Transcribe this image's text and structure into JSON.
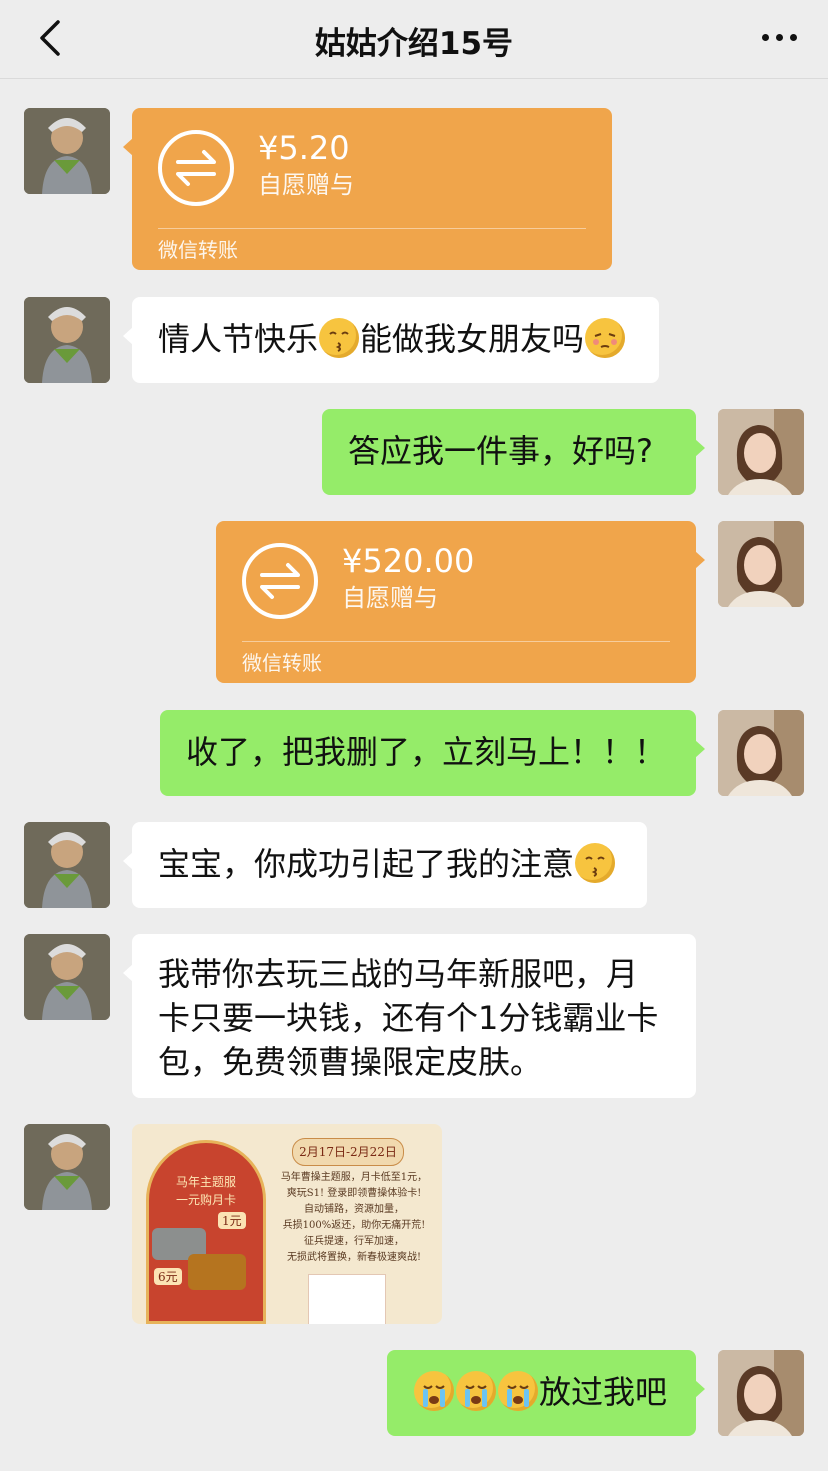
{
  "header": {
    "title": "姑姑介绍15号",
    "back_icon": "chevron-left-icon",
    "more_icon": "more-dots-icon"
  },
  "colors": {
    "background": "#ededed",
    "green_bubble": "#95ec69",
    "transfer_orange": "#f0a54b",
    "white_bubble": "#ffffff"
  },
  "messages": [
    {
      "side": "left",
      "type": "transfer",
      "amount": "¥5.20",
      "desc": "自愿赠与",
      "label": "微信转账"
    },
    {
      "side": "left",
      "type": "text",
      "text_a": "情人节快乐",
      "emoji_a": "kissing-face-emoji",
      "text_b": "能做我女朋友吗",
      "emoji_b": "shy-face-emoji"
    },
    {
      "side": "right",
      "type": "text",
      "text": "答应我一件事，好吗?"
    },
    {
      "side": "right",
      "type": "transfer",
      "amount": "¥520.00",
      "desc": "自愿赠与",
      "label": "微信转账"
    },
    {
      "side": "right",
      "type": "text",
      "text": "收了，把我删了，立刻马上！！！"
    },
    {
      "side": "left",
      "type": "text",
      "text": "宝宝，你成功引起了我的注意",
      "emoji": "kissing-face-emoji"
    },
    {
      "side": "left",
      "type": "text",
      "lines": [
        "我带你去玩三战的马年新服吧，月",
        "卡只要一块钱，还有个1分钱霸业卡",
        "包，免费领曹操限定皮肤。"
      ]
    },
    {
      "side": "left",
      "type": "image",
      "ad": {
        "arch_title_1": "马年主题服",
        "arch_title_2": "一元购月卡",
        "price_1": "1元",
        "price_2": "6元",
        "date": "2月17日-2月22日",
        "lines": [
          "马年曹操主题服，月卡低至1元，",
          "爽玩S1! 登录即领曹操体验卡!",
          "自动铺路，资源加量，",
          "兵损100%返还，助你无痛开荒!",
          "征兵提速，行军加速，",
          "无损武将置换，新春极速爽战!"
        ]
      }
    },
    {
      "side": "right",
      "type": "text",
      "text": "放过我吧",
      "emoji": "crying-face-emoji",
      "emoji_count": 3
    }
  ]
}
